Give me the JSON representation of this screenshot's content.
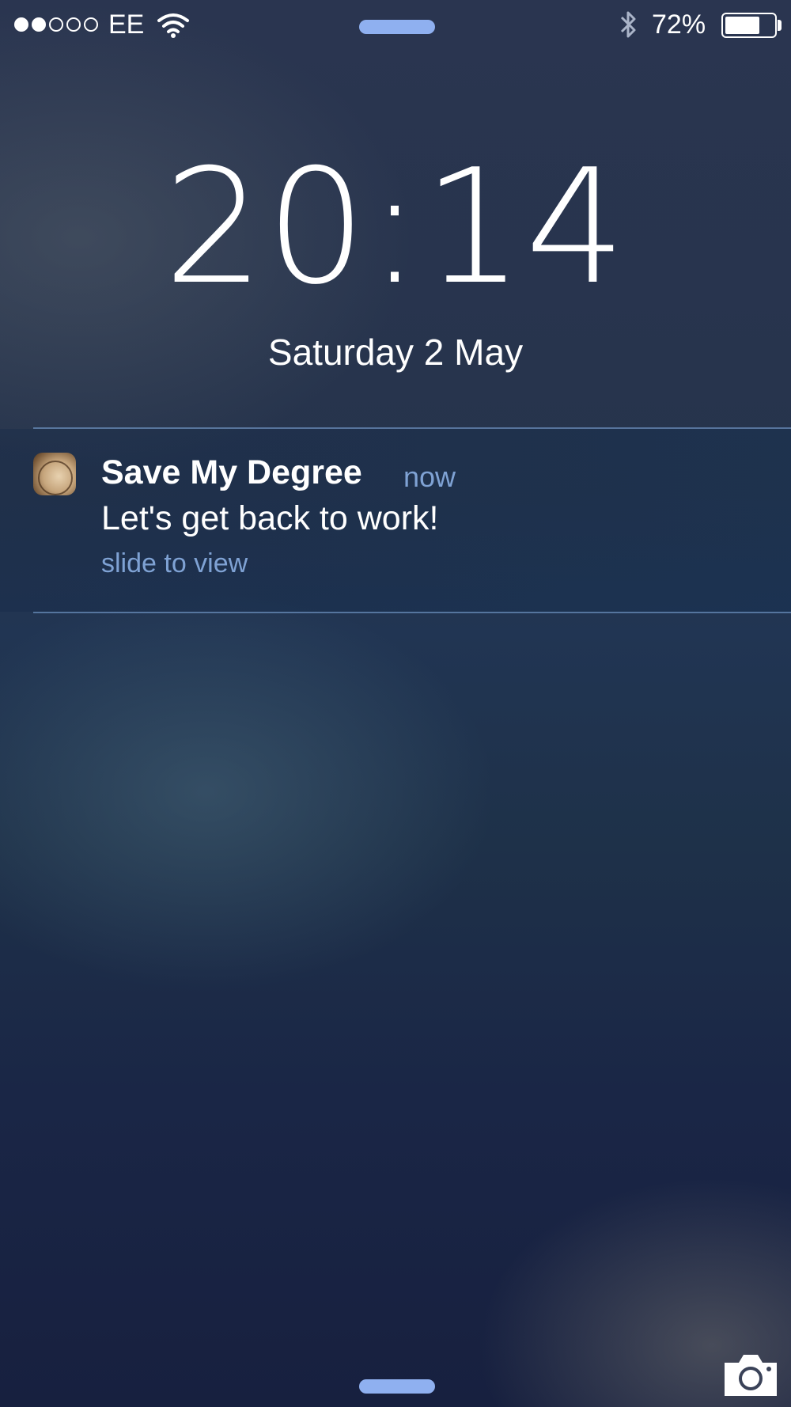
{
  "status_bar": {
    "carrier": "EE",
    "signal_bars_filled": 2,
    "signal_bars_total": 5,
    "wifi_icon": "wifi-icon",
    "bluetooth_icon": "bluetooth-icon",
    "battery_percent_label": "72%",
    "battery_level": 0.72
  },
  "lock_screen": {
    "time": "20:14",
    "date": "Saturday 2 May"
  },
  "notification": {
    "app_icon": "clock-app-icon",
    "app_name": "Save My Degree",
    "time": "now",
    "message": "Let's get back to work!",
    "action_hint": "slide to view"
  },
  "bottom": {
    "camera_icon": "camera-icon"
  },
  "colors": {
    "accent": "#7fa2d4",
    "grabber": "#8fb0f0"
  }
}
